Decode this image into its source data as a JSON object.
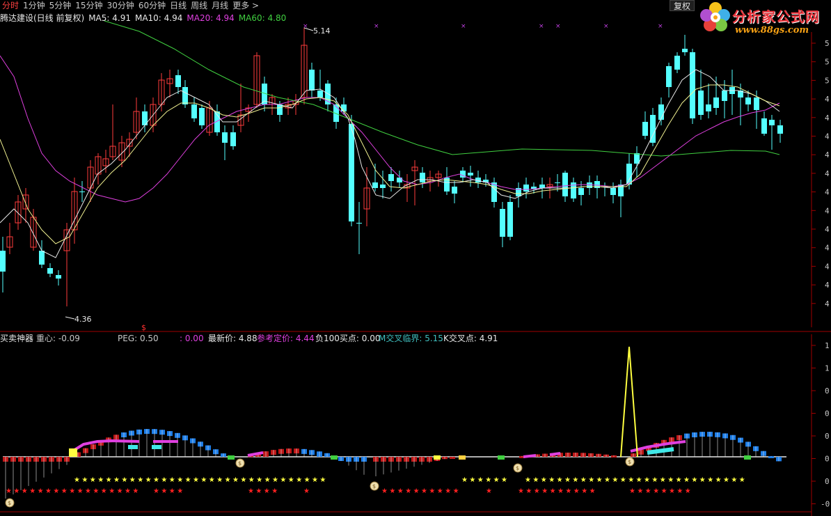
{
  "tabs": [
    {
      "label": "分时",
      "active": true
    },
    {
      "label": "1分钟",
      "active": false
    },
    {
      "label": "5分钟",
      "active": false
    },
    {
      "label": "15分钟",
      "active": false
    },
    {
      "label": "30分钟",
      "active": false
    },
    {
      "label": "60分钟",
      "active": false
    },
    {
      "label": "日线",
      "active": false
    },
    {
      "label": "周线",
      "active": false
    },
    {
      "label": "月线",
      "active": false
    },
    {
      "label": "更多 >",
      "active": false
    }
  ],
  "fuquan_button": "复权",
  "logo": {
    "title": "分析家公式网",
    "url": "www.88gs.com"
  },
  "main_chart": {
    "name": "腾达建设(日线 前复权)",
    "ma": [
      {
        "label": "MA5: 4.91",
        "color": "#e8e8e8"
      },
      {
        "label": "MA10: 4.94",
        "color": "#e8e8e8"
      },
      {
        "label": "MA20: 4.94",
        "color": "#e040e0"
      },
      {
        "label": "MA60: 4.80",
        "color": "#40d040"
      }
    ],
    "high_label": "5.14",
    "low_label": "4.36",
    "right_axis_digits": [
      "5",
      "5",
      "5",
      "4",
      "4",
      "4",
      "4",
      "4",
      "4",
      "4",
      "4",
      "4",
      "4",
      "4",
      "4"
    ]
  },
  "sub_chart": {
    "title": "买卖神器",
    "items": [
      {
        "label": "重心: -0.09",
        "color": "#c8c8c8"
      },
      {
        "label": "PEG: 0.50",
        "color": "#c8c8c8"
      },
      {
        "label": ": 0.00",
        "color": "#e040e0"
      },
      {
        "label": "最新价: 4.88",
        "color": "#e8e8e8"
      },
      {
        "label": "参考定价: 4.44",
        "color": "#e040e0"
      },
      {
        "label": "负100买点: 0.00",
        "color": "#e8e8e8"
      },
      {
        "label": "M交叉临界: 5.15",
        "color": "#40c0c0"
      },
      {
        "label": "K交叉点: 4.91",
        "color": "#e8e8e8"
      }
    ],
    "dollar_marker": "$",
    "right_axis_digits": [
      "1",
      "1",
      "0",
      "0",
      "0",
      "0",
      "0",
      "-0"
    ]
  },
  "colors": {
    "up": "#ff3c3c",
    "down": "#54ffff",
    "ma_white": "#e8e8e8",
    "ma_yellow": "#f0f090",
    "ma_magenta": "#e040e0",
    "ma_green": "#40d040",
    "axis": "#a00000",
    "star_yellow": "#ffff40",
    "star_red": "#ff2020"
  }
}
